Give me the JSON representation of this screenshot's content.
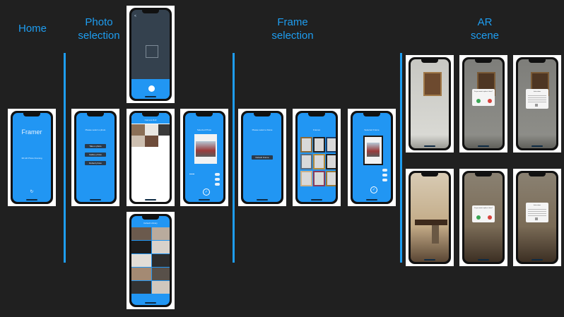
{
  "sections": {
    "home": "Home",
    "photo_selection": "Photo\nselection",
    "frame_selection": "Frame\nselection",
    "ar_scene": "AR\nscene"
  },
  "screens": {
    "home": {
      "app_title": "Framer",
      "subtitle": "3D AR Photo Framing"
    },
    "photo_options": {
      "title": "Please select a photo",
      "buttons": [
        "Take a photo",
        "Gallery photo",
        "Default photo"
      ]
    },
    "camera_roll": {
      "title": "Camera Roll"
    },
    "default_library": {
      "title": "Default Library"
    },
    "selected_photo": {
      "title": "Selected Photo"
    },
    "frame_prompt": {
      "title": "Please select a frame",
      "button": "Default Frame"
    },
    "frame_list": {
      "title": "Frames"
    },
    "selected_frame": {
      "title": "Selected Frame"
    },
    "ar_dialog_confirm": {
      "title": "Do you want to place it here?"
    },
    "ar_dialog_info": {
      "title": "Instructions"
    },
    "ar_dialog_confirm_2": {
      "title": "Do you want to place it here?"
    },
    "ar_dialog_info_2": {
      "title": "Instructions"
    }
  },
  "colors": {
    "accent": "#1e9df0",
    "screen_blue": "#2196f3",
    "background": "#202020"
  }
}
